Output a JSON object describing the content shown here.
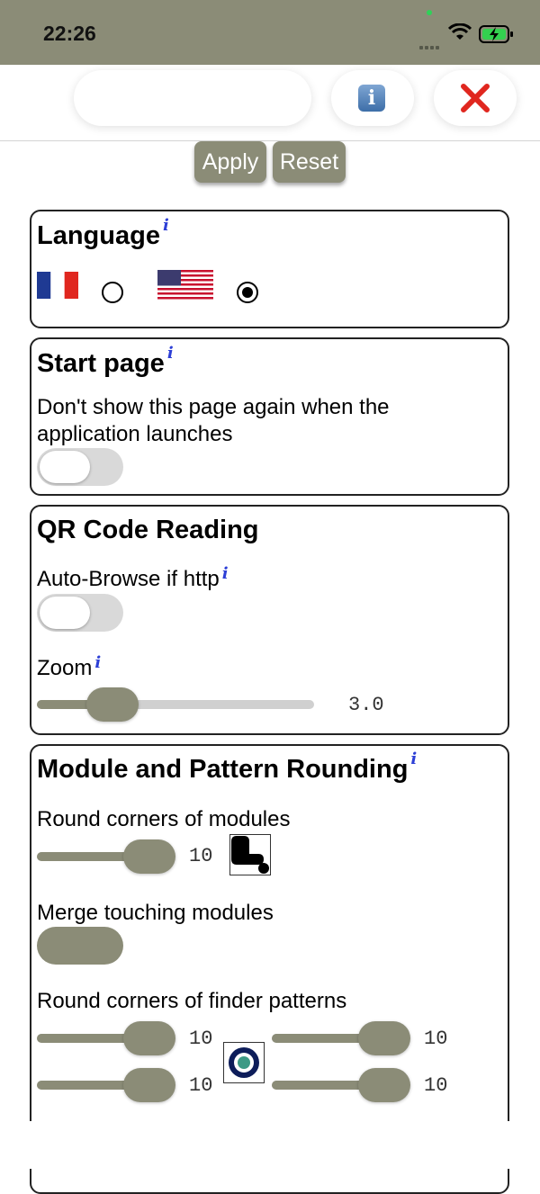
{
  "status": {
    "time": "22:26"
  },
  "toolbar": {
    "info_icon": "info-icon",
    "close_icon": "close-icon"
  },
  "actions": {
    "apply_label": "Apply",
    "reset_label": "Reset"
  },
  "language": {
    "title": "Language",
    "info_mark": "i",
    "options": [
      {
        "flag": "france-flag",
        "selected": false
      },
      {
        "flag": "usa-flag",
        "selected": true
      }
    ]
  },
  "start_page": {
    "title": "Start page",
    "info_mark": "i",
    "description": "Don't show this page again when the application launches",
    "toggle_on": false
  },
  "qr_reading": {
    "title": "QR Code Reading",
    "auto_browse_label": "Auto-Browse if http",
    "auto_browse_on": false,
    "zoom_label": "Zoom",
    "zoom_value": "3.0",
    "zoom_fraction": 0.27
  },
  "rounding": {
    "title": "Module and Pattern Rounding",
    "round_modules_label": "Round corners of modules",
    "round_modules_value": "10",
    "merge_label": "Merge touching modules",
    "merge_on": true,
    "finder_label": "Round corners of finder patterns",
    "finder_values": [
      "10",
      "10",
      "10",
      "10"
    ]
  },
  "colors": {
    "accent": "#8b8c77",
    "info_blue": "#2d3fd6",
    "close_red": "#e0271f"
  }
}
